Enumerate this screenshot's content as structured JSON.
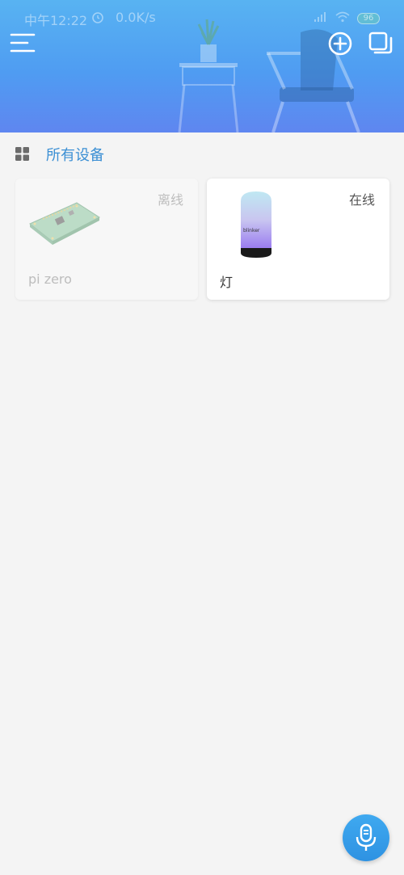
{
  "status_bar": {
    "time": "中午12:22",
    "net_speed": "0.0K/s",
    "battery": "96",
    "icons": [
      "alarm-icon",
      "signal-icon",
      "wifi-icon",
      "battery-icon"
    ]
  },
  "header": {
    "menu_icon": "menu-icon",
    "add_icon": "add-circle-icon",
    "multi_icon": "multi-window-icon"
  },
  "section": {
    "icon": "grid-icon",
    "title": "所有设备"
  },
  "devices": [
    {
      "name": "pi zero",
      "status": "离线",
      "image": "raspberry-pi-board"
    },
    {
      "name": "灯",
      "status": "在线",
      "image": "lamp-cylinder"
    }
  ],
  "mic": {
    "icon": "microphone-icon"
  },
  "colors": {
    "accent": "#3b8fd4",
    "header_top": "#58b3f2",
    "header_bottom": "#5f86f0",
    "background": "#f4f4f4",
    "mic": "#3fa9f0"
  }
}
